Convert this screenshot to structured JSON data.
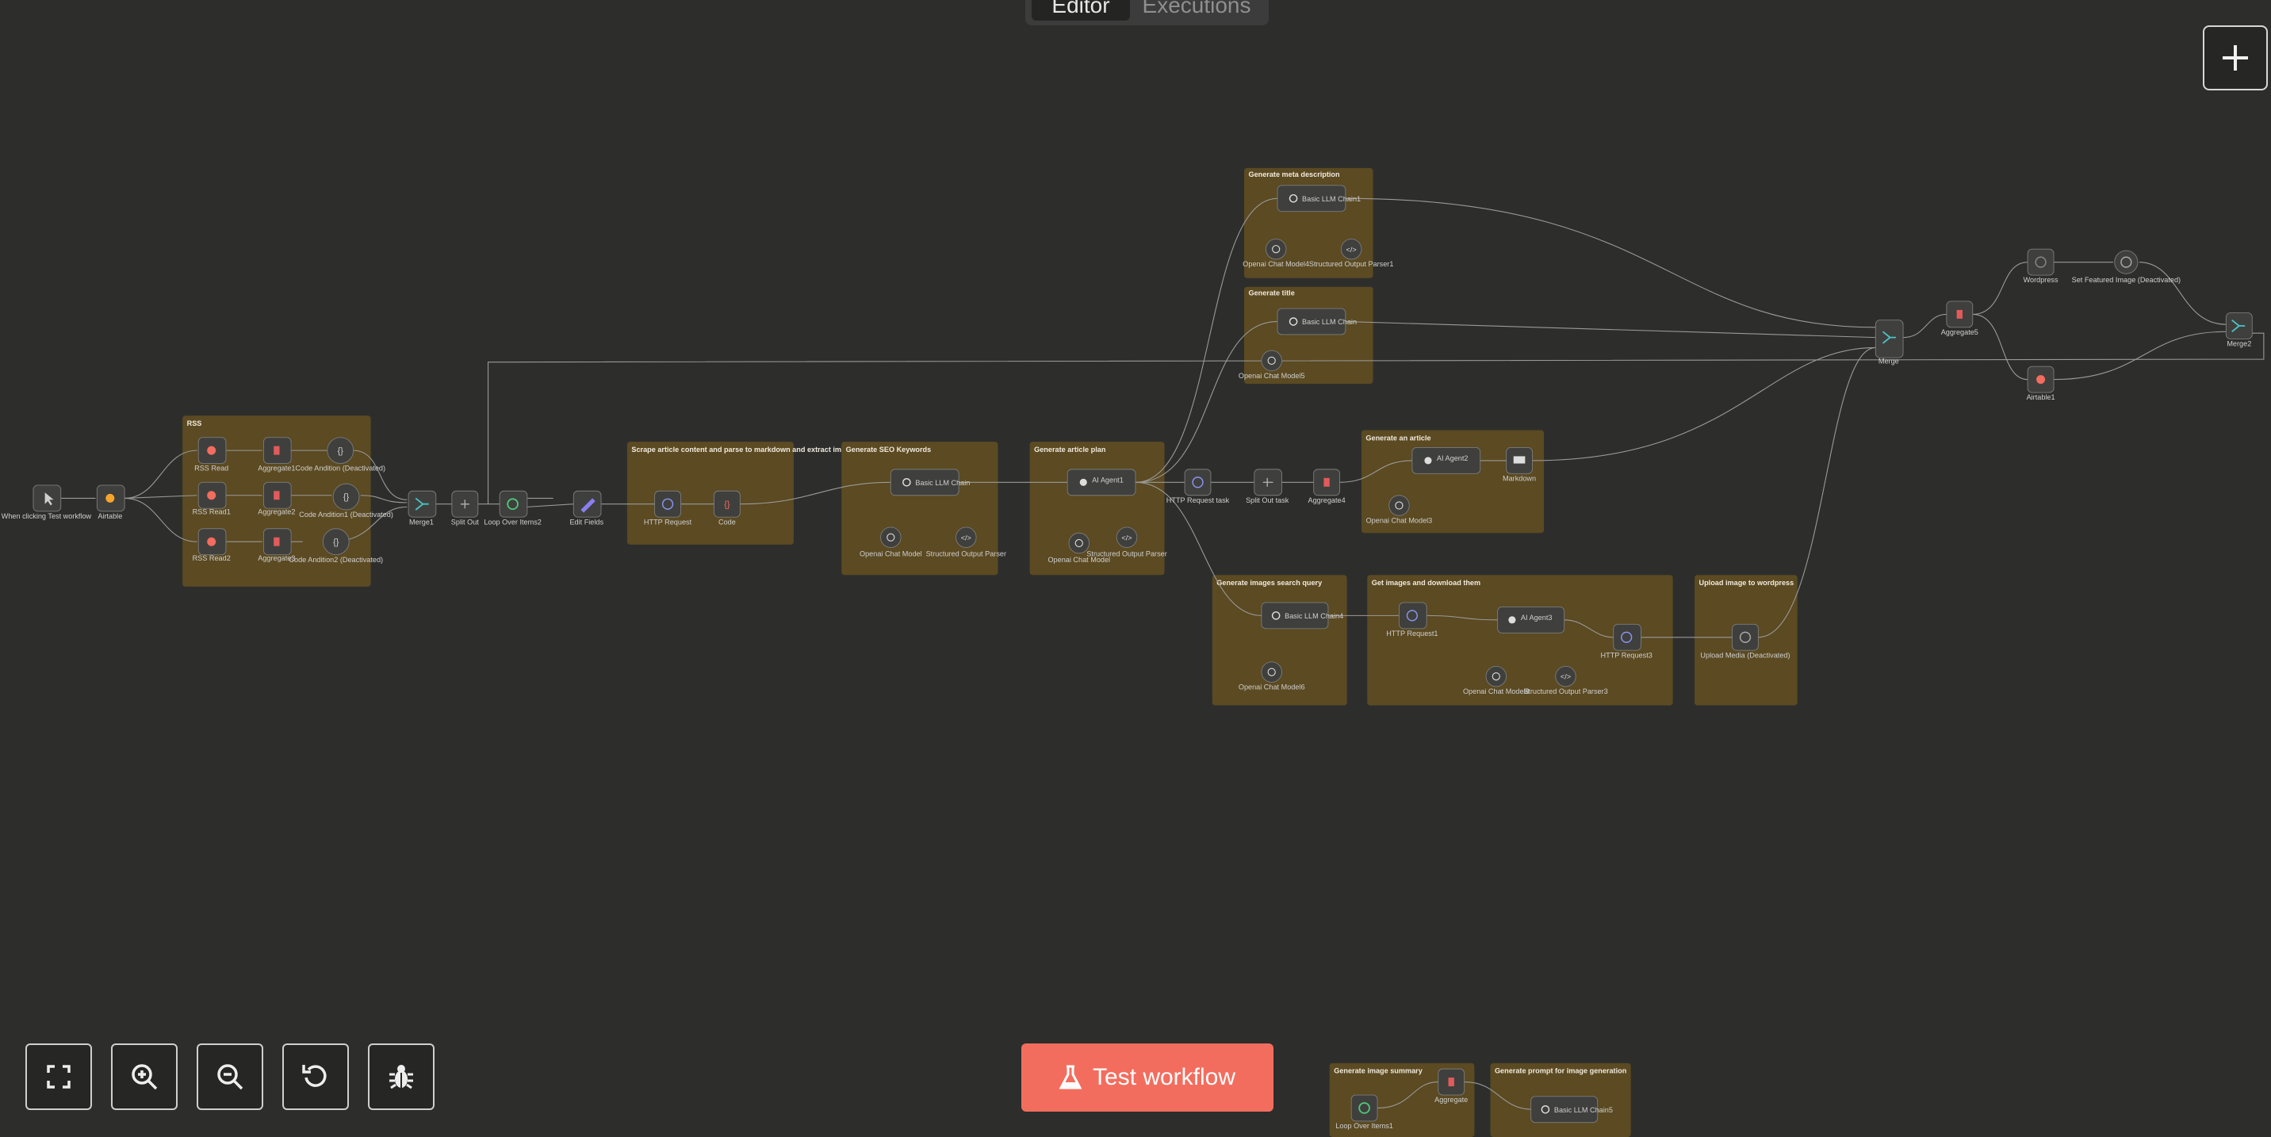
{
  "header": {
    "tabs": [
      {
        "label": "Editor",
        "active": true
      },
      {
        "label": "Executions",
        "active": false
      }
    ]
  },
  "add_node_label": "+",
  "controls": {
    "test_button_label": "Test workflow"
  },
  "stickies": [
    {
      "id": "rss",
      "label": "RSS"
    },
    {
      "id": "scrape",
      "label": "Scrape article content and parse to markdown and extract images"
    },
    {
      "id": "seo",
      "label": "Generate SEO Keywords"
    },
    {
      "id": "plan",
      "label": "Generate article plan"
    },
    {
      "id": "meta",
      "label": "Generate meta description"
    },
    {
      "id": "title",
      "label": "Generate title"
    },
    {
      "id": "article",
      "label": "Generate an article"
    },
    {
      "id": "imgquery",
      "label": "Generate images search query"
    },
    {
      "id": "download",
      "label": "Get images and download them"
    },
    {
      "id": "upload",
      "label": "Upload image to wordpress"
    },
    {
      "id": "imgsummary",
      "label": "Generate image summary"
    },
    {
      "id": "imgprompt",
      "label": "Generate prompt for image generation"
    }
  ],
  "nodes": [
    {
      "id": "trigger",
      "label": "When clicking Test workflow",
      "icon": "cursor-icon"
    },
    {
      "id": "airtable",
      "label": "Airtable",
      "icon": "airtable-icon"
    },
    {
      "id": "rss1",
      "label": "RSS Read",
      "icon": "rss-icon"
    },
    {
      "id": "rss2",
      "label": "RSS Read1",
      "icon": "rss-icon"
    },
    {
      "id": "rss3",
      "label": "RSS Read2",
      "icon": "rss-icon"
    },
    {
      "id": "agg1",
      "label": "Aggregate1",
      "icon": "aggregate-icon"
    },
    {
      "id": "agg2",
      "label": "Aggregate2",
      "icon": "aggregate-icon"
    },
    {
      "id": "agg3",
      "label": "Aggregate3",
      "icon": "aggregate-icon"
    },
    {
      "id": "code1",
      "label": "Code Andition (Deactivated)",
      "icon": "code-icon"
    },
    {
      "id": "code2",
      "label": "Code Andition1 (Deactivated)",
      "icon": "code-icon"
    },
    {
      "id": "code3",
      "label": "Code Andition2 (Deactivated)",
      "icon": "code-icon"
    },
    {
      "id": "merge1",
      "label": "Merge1",
      "icon": "merge-icon"
    },
    {
      "id": "splitout",
      "label": "Split Out",
      "icon": "split-icon"
    },
    {
      "id": "loop",
      "label": "Loop Over Items2",
      "icon": "loop-icon"
    },
    {
      "id": "editfields",
      "label": "Edit Fields",
      "icon": "pencil-icon"
    },
    {
      "id": "http1",
      "label": "HTTP Request",
      "icon": "globe-icon"
    },
    {
      "id": "code",
      "label": "Code",
      "icon": "code-icon"
    },
    {
      "id": "llmseo",
      "label": "Basic LLM Chain",
      "icon": "link-icon"
    },
    {
      "id": "openai1",
      "label": "Openai Chat Model",
      "icon": "openai-icon"
    },
    {
      "id": "parser1",
      "label": "Structured Output Parser",
      "icon": "parser-icon"
    },
    {
      "id": "aiagent1",
      "label": "AI Agent1",
      "icon": "robot-icon"
    },
    {
      "id": "openai2",
      "label": "Openai Chat Model",
      "icon": "openai-icon"
    },
    {
      "id": "parser2",
      "label": "Structured Output Parser",
      "icon": "parser-icon"
    },
    {
      "id": "http2",
      "label": "HTTP Request task",
      "icon": "globe-icon"
    },
    {
      "id": "splitout2",
      "label": "Split Out task",
      "icon": "split-icon"
    },
    {
      "id": "agg4",
      "label": "Aggregate4",
      "icon": "aggregate-icon"
    },
    {
      "id": "aiagent2",
      "label": "AI Agent2",
      "icon": "robot-icon"
    },
    {
      "id": "markdown",
      "label": "Markdown",
      "icon": "markdown-icon"
    },
    {
      "id": "openai3",
      "label": "Openai Chat Model3",
      "icon": "openai-icon"
    },
    {
      "id": "llmmeta",
      "label": "Basic LLM Chain1",
      "icon": "link-icon"
    },
    {
      "id": "openai4",
      "label": "Openai Chat Model4",
      "icon": "openai-icon"
    },
    {
      "id": "parser3",
      "label": "Structured Output Parser1",
      "icon": "parser-icon"
    },
    {
      "id": "llmtitle",
      "label": "Basic LLM Chain",
      "icon": "link-icon"
    },
    {
      "id": "openai5",
      "label": "Openai Chat Model5",
      "icon": "openai-icon"
    },
    {
      "id": "llmimg",
      "label": "Basic LLM Chain4",
      "icon": "link-icon"
    },
    {
      "id": "openai6",
      "label": "Openai Chat Model6",
      "icon": "openai-icon"
    },
    {
      "id": "http3",
      "label": "HTTP Request1",
      "icon": "globe-icon"
    },
    {
      "id": "aiagent3",
      "label": "AI Agent3",
      "icon": "robot-icon"
    },
    {
      "id": "openai7",
      "label": "Openai Chat Model8",
      "icon": "openai-icon"
    },
    {
      "id": "parser4",
      "label": "Structured Output Parser3",
      "icon": "parser-icon"
    },
    {
      "id": "http4",
      "label": "HTTP Request3",
      "icon": "globe-icon"
    },
    {
      "id": "upload",
      "label": "Upload Media (Deactivated)",
      "icon": "globe-icon"
    },
    {
      "id": "merge",
      "label": "Merge",
      "icon": "merge-icon"
    },
    {
      "id": "agg5",
      "label": "Aggregate5",
      "icon": "aggregate-icon"
    },
    {
      "id": "wordpress",
      "label": "Wordpress",
      "icon": "wordpress-icon"
    },
    {
      "id": "featured",
      "label": "Set Featured Image (Deactivated)",
      "icon": "globe-icon"
    },
    {
      "id": "airtable2",
      "label": "Airtable1",
      "icon": "airtable-icon"
    },
    {
      "id": "merge2",
      "label": "Merge2",
      "icon": "merge-icon"
    },
    {
      "id": "loop2",
      "label": "Loop Over Items1",
      "icon": "loop-icon"
    },
    {
      "id": "agg6",
      "label": "Aggregate",
      "icon": "aggregate-icon"
    },
    {
      "id": "llmprompt",
      "label": "Basic LLM Chain5",
      "icon": "link-icon"
    }
  ],
  "colors": {
    "background": "#2d2e2c",
    "sticky": "#5b4a22",
    "node": "#3f403d",
    "accent": "#f36d5e"
  }
}
